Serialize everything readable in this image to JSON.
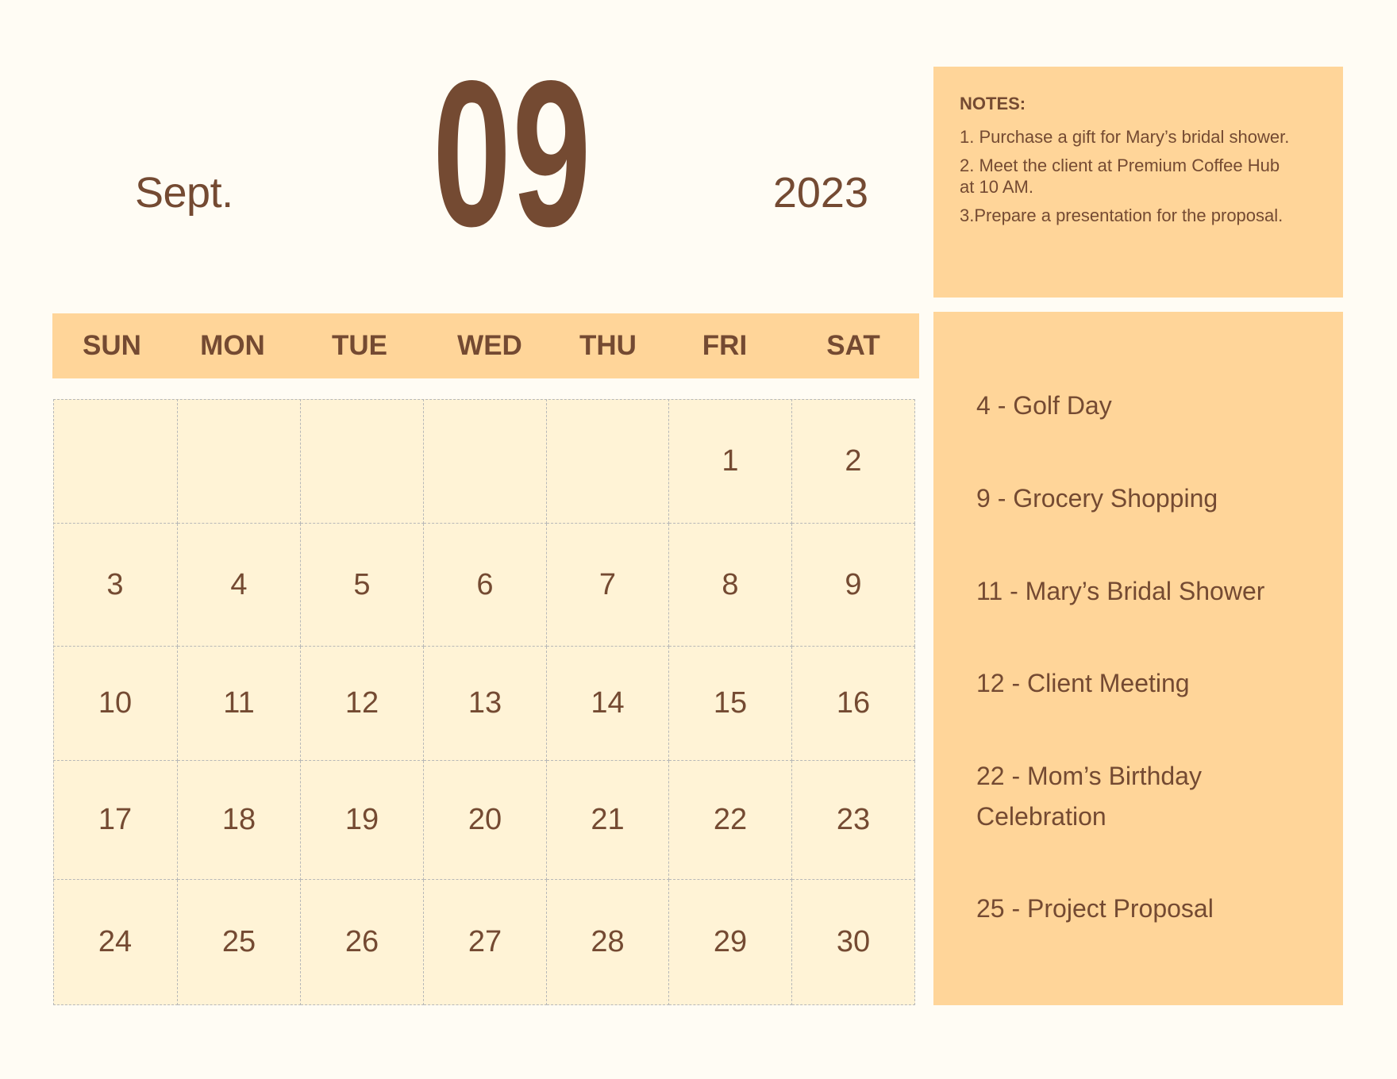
{
  "header": {
    "month_name": "Sept.",
    "month_number": "09",
    "year": "2023"
  },
  "notes": {
    "title": "NOTES:",
    "items": [
      "1. Purchase a gift for Mary’s bridal shower.",
      "2. Meet the client at Premium Coffee Hub at 10 AM.",
      "3.Prepare a presentation for the proposal."
    ]
  },
  "calendar": {
    "weekdays": [
      "SUN",
      "MON",
      "TUE",
      "WED",
      "THU",
      "FRI",
      "SAT"
    ],
    "weeks": [
      [
        "",
        "",
        "",
        "",
        "",
        "1",
        "2"
      ],
      [
        "3",
        "4",
        "5",
        "6",
        "7",
        "8",
        "9"
      ],
      [
        "10",
        "11",
        "12",
        "13",
        "14",
        "15",
        "16"
      ],
      [
        "17",
        "18",
        "19",
        "20",
        "21",
        "22",
        "23"
      ],
      [
        "24",
        "25",
        "26",
        "27",
        "28",
        "29",
        "30"
      ]
    ]
  },
  "events": [
    "4 - Golf Day",
    "9 - Grocery Shopping",
    "11 - Mary’s Bridal Shower",
    "12 - Client Meeting",
    "22 - Mom’s Birthday Celebration",
    "25 - Project Proposal"
  ],
  "colors": {
    "background": "#FFFCF4",
    "accent": "#FFD599",
    "cell": "#FFF3D6",
    "text": "#744A32",
    "grid_line": "#B8B8B8"
  }
}
